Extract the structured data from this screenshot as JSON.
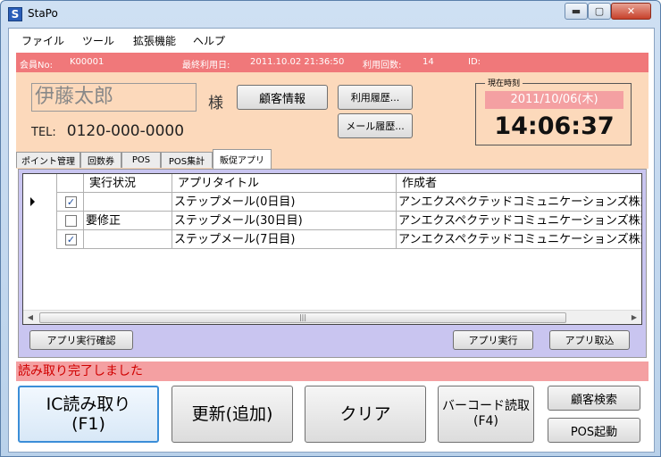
{
  "window": {
    "title": "StaPo",
    "minimize": "▬",
    "maximize": "▢",
    "close": "✕"
  },
  "menu": [
    "ファイル",
    "ツール",
    "拡張機能",
    "ヘルプ"
  ],
  "member": {
    "id_label": "会員No:",
    "id_value": "K00001",
    "last_use_label": "最終利用日:",
    "last_use_value": "2011.10.02 21:36:50",
    "use_count_label": "利用回数:",
    "use_count_value": "14",
    "id2_label": "ID:",
    "id2_value": ""
  },
  "customer": {
    "name": "伊藤太郎",
    "honorific": "様",
    "tel_label": "TEL:",
    "tel_value": "0120-000-0000"
  },
  "buttons": {
    "customer_info": "顧客情報",
    "usage_history": "利用履歴...",
    "mail_history": "メール履歴...",
    "app_exec_confirm": "アプリ実行確認",
    "app_exec": "アプリ実行",
    "app_import": "アプリ取込",
    "ic_read_1": "IC読み取り",
    "ic_read_2": "(F1)",
    "update": "更新(追加)",
    "clear": "クリア",
    "barcode_1": "バーコード読取",
    "barcode_2": "(F4)",
    "customer_search": "顧客検索",
    "pos_start": "POS起動"
  },
  "clock": {
    "label": "現在時刻",
    "date": "2011/10/06(木)",
    "time": "14:06:37"
  },
  "tabs": [
    "ポイント管理",
    "回数券",
    "POS",
    "POS集計",
    "販促アプリ"
  ],
  "active_tab": 4,
  "grid": {
    "columns": [
      "実行状況",
      "アプリタイトル",
      "作成者"
    ],
    "rows": [
      {
        "checked": true,
        "status": "",
        "title": "ステップメール(0日目)",
        "author": "アンエクスペクテッドコミュニケーションズ株式",
        "current": true
      },
      {
        "checked": false,
        "status": "要修正",
        "title": "ステップメール(30日目)",
        "author": "アンエクスペクテッドコミュニケーションズ株式",
        "current": false
      },
      {
        "checked": true,
        "status": "",
        "title": "ステップメール(7日目)",
        "author": "アンエクスペクテッドコミュニケーションズ株式",
        "current": false
      }
    ],
    "scroll_left": "◀",
    "scroll_right": "▶",
    "scroll_grip": "|||"
  },
  "status_message": "読み取り完了しました",
  "colors": {
    "panel": "#fcd9bb",
    "member_bar": "#f0787a",
    "status_bar": "#f4a0a2",
    "grid_panel": "#c9c5f0"
  }
}
